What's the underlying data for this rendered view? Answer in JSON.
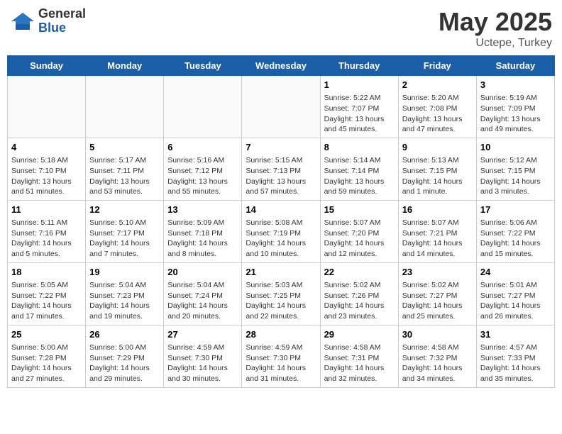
{
  "header": {
    "logo_general": "General",
    "logo_blue": "Blue",
    "title": "May 2025",
    "location": "Uctepe, Turkey"
  },
  "days_of_week": [
    "Sunday",
    "Monday",
    "Tuesday",
    "Wednesday",
    "Thursday",
    "Friday",
    "Saturday"
  ],
  "weeks": [
    [
      {
        "day": "",
        "info": ""
      },
      {
        "day": "",
        "info": ""
      },
      {
        "day": "",
        "info": ""
      },
      {
        "day": "",
        "info": ""
      },
      {
        "day": "1",
        "info": "Sunrise: 5:22 AM\nSunset: 7:07 PM\nDaylight: 13 hours and 45 minutes."
      },
      {
        "day": "2",
        "info": "Sunrise: 5:20 AM\nSunset: 7:08 PM\nDaylight: 13 hours and 47 minutes."
      },
      {
        "day": "3",
        "info": "Sunrise: 5:19 AM\nSunset: 7:09 PM\nDaylight: 13 hours and 49 minutes."
      }
    ],
    [
      {
        "day": "4",
        "info": "Sunrise: 5:18 AM\nSunset: 7:10 PM\nDaylight: 13 hours and 51 minutes."
      },
      {
        "day": "5",
        "info": "Sunrise: 5:17 AM\nSunset: 7:11 PM\nDaylight: 13 hours and 53 minutes."
      },
      {
        "day": "6",
        "info": "Sunrise: 5:16 AM\nSunset: 7:12 PM\nDaylight: 13 hours and 55 minutes."
      },
      {
        "day": "7",
        "info": "Sunrise: 5:15 AM\nSunset: 7:13 PM\nDaylight: 13 hours and 57 minutes."
      },
      {
        "day": "8",
        "info": "Sunrise: 5:14 AM\nSunset: 7:14 PM\nDaylight: 13 hours and 59 minutes."
      },
      {
        "day": "9",
        "info": "Sunrise: 5:13 AM\nSunset: 7:15 PM\nDaylight: 14 hours and 1 minute."
      },
      {
        "day": "10",
        "info": "Sunrise: 5:12 AM\nSunset: 7:15 PM\nDaylight: 14 hours and 3 minutes."
      }
    ],
    [
      {
        "day": "11",
        "info": "Sunrise: 5:11 AM\nSunset: 7:16 PM\nDaylight: 14 hours and 5 minutes."
      },
      {
        "day": "12",
        "info": "Sunrise: 5:10 AM\nSunset: 7:17 PM\nDaylight: 14 hours and 7 minutes."
      },
      {
        "day": "13",
        "info": "Sunrise: 5:09 AM\nSunset: 7:18 PM\nDaylight: 14 hours and 8 minutes."
      },
      {
        "day": "14",
        "info": "Sunrise: 5:08 AM\nSunset: 7:19 PM\nDaylight: 14 hours and 10 minutes."
      },
      {
        "day": "15",
        "info": "Sunrise: 5:07 AM\nSunset: 7:20 PM\nDaylight: 14 hours and 12 minutes."
      },
      {
        "day": "16",
        "info": "Sunrise: 5:07 AM\nSunset: 7:21 PM\nDaylight: 14 hours and 14 minutes."
      },
      {
        "day": "17",
        "info": "Sunrise: 5:06 AM\nSunset: 7:22 PM\nDaylight: 14 hours and 15 minutes."
      }
    ],
    [
      {
        "day": "18",
        "info": "Sunrise: 5:05 AM\nSunset: 7:22 PM\nDaylight: 14 hours and 17 minutes."
      },
      {
        "day": "19",
        "info": "Sunrise: 5:04 AM\nSunset: 7:23 PM\nDaylight: 14 hours and 19 minutes."
      },
      {
        "day": "20",
        "info": "Sunrise: 5:04 AM\nSunset: 7:24 PM\nDaylight: 14 hours and 20 minutes."
      },
      {
        "day": "21",
        "info": "Sunrise: 5:03 AM\nSunset: 7:25 PM\nDaylight: 14 hours and 22 minutes."
      },
      {
        "day": "22",
        "info": "Sunrise: 5:02 AM\nSunset: 7:26 PM\nDaylight: 14 hours and 23 minutes."
      },
      {
        "day": "23",
        "info": "Sunrise: 5:02 AM\nSunset: 7:27 PM\nDaylight: 14 hours and 25 minutes."
      },
      {
        "day": "24",
        "info": "Sunrise: 5:01 AM\nSunset: 7:27 PM\nDaylight: 14 hours and 26 minutes."
      }
    ],
    [
      {
        "day": "25",
        "info": "Sunrise: 5:00 AM\nSunset: 7:28 PM\nDaylight: 14 hours and 27 minutes."
      },
      {
        "day": "26",
        "info": "Sunrise: 5:00 AM\nSunset: 7:29 PM\nDaylight: 14 hours and 29 minutes."
      },
      {
        "day": "27",
        "info": "Sunrise: 4:59 AM\nSunset: 7:30 PM\nDaylight: 14 hours and 30 minutes."
      },
      {
        "day": "28",
        "info": "Sunrise: 4:59 AM\nSunset: 7:30 PM\nDaylight: 14 hours and 31 minutes."
      },
      {
        "day": "29",
        "info": "Sunrise: 4:58 AM\nSunset: 7:31 PM\nDaylight: 14 hours and 32 minutes."
      },
      {
        "day": "30",
        "info": "Sunrise: 4:58 AM\nSunset: 7:32 PM\nDaylight: 14 hours and 34 minutes."
      },
      {
        "day": "31",
        "info": "Sunrise: 4:57 AM\nSunset: 7:33 PM\nDaylight: 14 hours and 35 minutes."
      }
    ]
  ]
}
